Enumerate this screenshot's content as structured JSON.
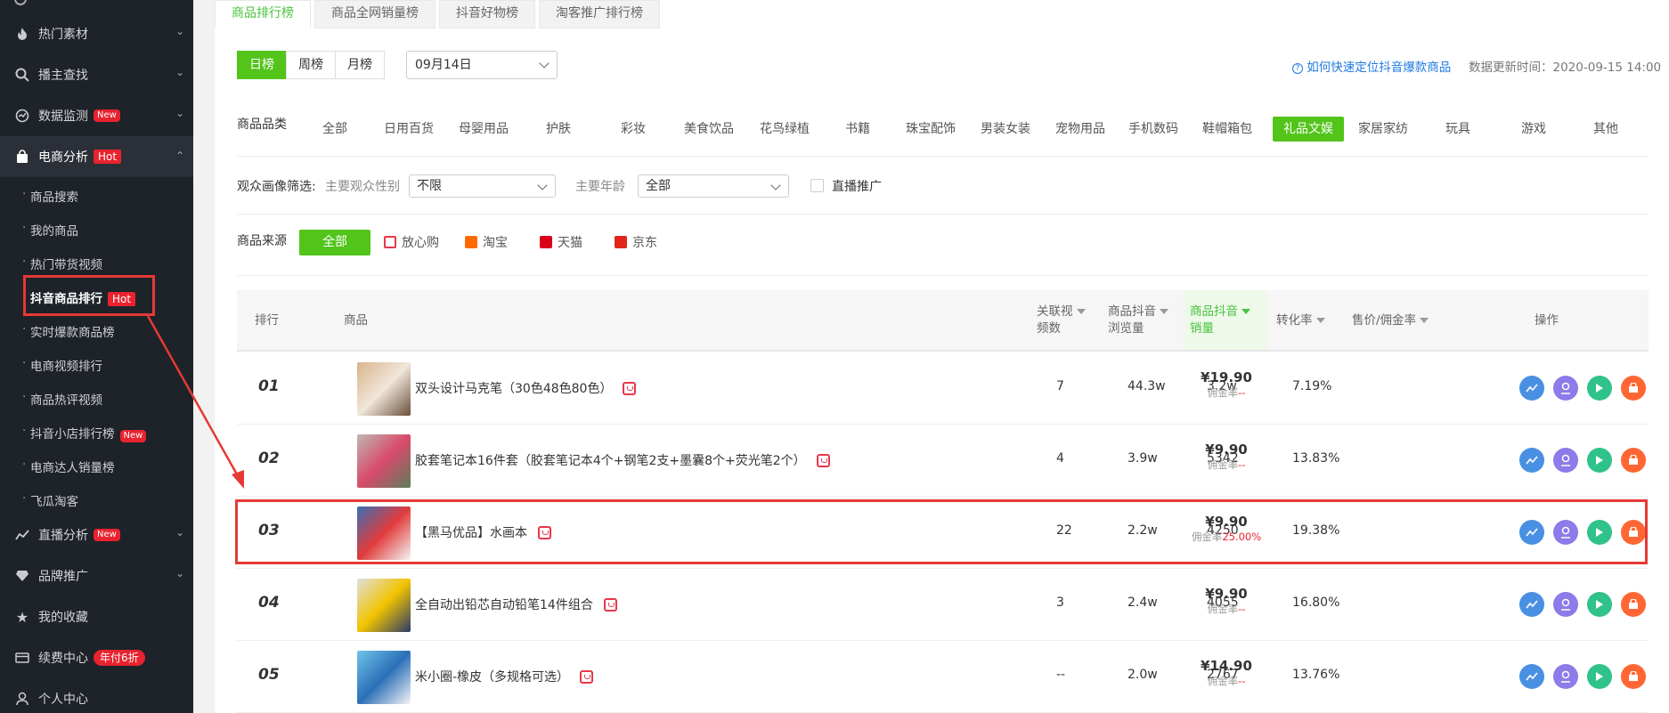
{
  "sidebar": {
    "items": [
      {
        "label": "热门素材",
        "icon": "fire-icon"
      },
      {
        "label": "播主查找",
        "icon": "search-icon"
      },
      {
        "label": "数据监测",
        "icon": "monitor-icon",
        "badge": "New"
      },
      {
        "label": "电商分析",
        "icon": "shop-bag-icon",
        "badge": "Hot"
      },
      {
        "label": "直播分析",
        "icon": "trend-icon",
        "badge": "New"
      },
      {
        "label": "品牌推广",
        "icon": "diamond-icon"
      },
      {
        "label": "我的收藏",
        "icon": "star-icon"
      },
      {
        "label": "续费中心",
        "icon": "card-icon",
        "badge": "年付6折"
      },
      {
        "label": "个人中心",
        "icon": "user-icon"
      }
    ],
    "subitems": [
      {
        "label": "商品搜索"
      },
      {
        "label": "我的商品"
      },
      {
        "label": "热门带货视频"
      },
      {
        "label": "抖音商品排行",
        "badge": "Hot"
      },
      {
        "label": "实时爆款商品榜"
      },
      {
        "label": "电商视频排行"
      },
      {
        "label": "商品热评视频"
      },
      {
        "label": "抖音小店排行榜",
        "badge": "New"
      },
      {
        "label": "电商达人销量榜"
      },
      {
        "label": "飞瓜淘客"
      }
    ]
  },
  "tabs": [
    "商品排行榜",
    "商品全网销量榜",
    "抖音好物榜",
    "淘客推广排行榜"
  ],
  "period": {
    "options": [
      "日榜",
      "周榜",
      "月榜"
    ],
    "selected": "日榜",
    "date": "09月14日"
  },
  "help_link": "如何快速定位抖音爆款商品",
  "update_time": "数据更新时间：2020-09-15 14:00",
  "category": {
    "label": "商品品类",
    "options": [
      "全部",
      "日用百货",
      "母婴用品",
      "护肤",
      "彩妆",
      "美食饮品",
      "花鸟绿植",
      "书籍",
      "珠宝配饰",
      "男装女装",
      "宠物用品",
      "手机数码",
      "鞋帽箱包",
      "礼品文娱",
      "家居家纺",
      "玩具",
      "游戏",
      "其他"
    ],
    "selected": "礼品文娱"
  },
  "audience": {
    "label": "观众画像筛选:",
    "gender_label": "主要观众性别",
    "gender_value": "不限",
    "age_label": "主要年龄",
    "age_value": "全部",
    "live_label": "直播推广"
  },
  "source": {
    "label": "商品来源",
    "options": [
      {
        "label": "全部",
        "color": "#52c41a"
      },
      {
        "label": "放心购",
        "color": "#e8374b"
      },
      {
        "label": "淘宝",
        "color": "#ff6a00"
      },
      {
        "label": "天猫",
        "color": "#d9001b"
      },
      {
        "label": "京东",
        "color": "#e1251b"
      }
    ]
  },
  "table": {
    "headers": {
      "rank": "排行",
      "product": "商品",
      "videos_a": "关联视",
      "videos_b": "频数",
      "views_a": "商品抖音",
      "views_b": "浏览量",
      "sales_a": "商品抖音",
      "sales_b": "销量",
      "conversion": "转化率",
      "price": "售价/佣金率",
      "ops": "操作"
    },
    "rows": [
      {
        "rank": "01",
        "name": "双头设计马克笔（30色48色80色）",
        "videos": "7",
        "views": "44.3w",
        "sales": "3.2w",
        "conv": "7.19%",
        "price": "¥19.90",
        "commission_label": "佣金率",
        "commission": "--"
      },
      {
        "rank": "02",
        "name": "胶套笔记本16件套（胶套笔记本4个+钢笔2支+墨囊8个+荧光笔2个）",
        "videos": "4",
        "views": "3.9w",
        "sales": "5342",
        "conv": "13.83%",
        "price": "¥9.90",
        "commission_label": "佣金率",
        "commission": "--"
      },
      {
        "rank": "03",
        "name": "【黑马优品】水画本",
        "videos": "22",
        "views": "2.2w",
        "sales": "4250",
        "conv": "19.38%",
        "price": "¥9.90",
        "commission_label": "佣金率",
        "commission": "25.00%"
      },
      {
        "rank": "04",
        "name": "全自动出铅芯自动铅笔14件组合",
        "videos": "3",
        "views": "2.4w",
        "sales": "4055",
        "conv": "16.80%",
        "price": "¥9.90",
        "commission_label": "佣金率",
        "commission": "--"
      },
      {
        "rank": "05",
        "name": "米小圈-橡皮（多规格可选）",
        "videos": "--",
        "views": "2.0w",
        "sales": "2767",
        "conv": "13.76%",
        "price": "¥14.90",
        "commission_label": "佣金率",
        "commission": "--"
      }
    ]
  },
  "op_icons": [
    {
      "name": "trend-chart-icon",
      "color": "#4a90e2"
    },
    {
      "name": "creator-icon",
      "color": "#8e7ae8"
    },
    {
      "name": "video-play-icon",
      "color": "#2fc28a"
    },
    {
      "name": "shop-icon",
      "color": "#ff6633"
    }
  ],
  "colors": {
    "accent": "#52c41a",
    "sidebar_bg": "#1e2229",
    "highlight_red": "#e53935",
    "link_blue": "#1f7ae0"
  }
}
